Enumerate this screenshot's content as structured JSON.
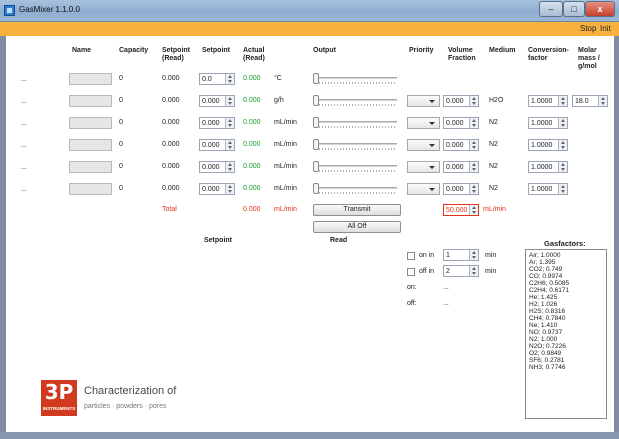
{
  "window": {
    "title": "GasMixer 1.1.0.0",
    "minimize": "–",
    "maximize": "□",
    "close": "x"
  },
  "menu": {
    "stop": "Stop",
    "init": "Init"
  },
  "headers": {
    "name": "Name",
    "capacity": "Capacity",
    "setpoint_read": "Setpoint\n(Read)",
    "setpoint": "Setpoint",
    "actual_read": "Actual\n(Read)",
    "output": "Output",
    "priority": "Priority",
    "volume_fraction": "Volume\nFraction",
    "medium": "Medium",
    "conversion_factor": "Conversion-\nfactor",
    "molar_mass": "Molar\nmass /\ng/mol"
  },
  "rows": [
    {
      "dots": "...",
      "capacity": "0",
      "setpoint_read": "0.000",
      "setpoint": "0.0",
      "actual": "0.000",
      "unit": "°C",
      "output_level": 0
    },
    {
      "dots": "...",
      "capacity": "0",
      "setpoint_read": "0.000",
      "setpoint": "0.000",
      "actual": "0.000",
      "unit": "g/h",
      "output_level": 0,
      "priority": "",
      "volume_fraction": "0.000",
      "medium": "H2O",
      "conversion_factor": "1.0000",
      "molar_mass": "18.0"
    },
    {
      "dots": "...",
      "capacity": "0",
      "setpoint_read": "0.000",
      "setpoint": "0.000",
      "actual": "0.000",
      "unit": "mL/min",
      "output_level": 0,
      "priority": "",
      "volume_fraction": "0.000",
      "medium": "N2",
      "conversion_factor": "1.0000"
    },
    {
      "dots": "...",
      "capacity": "0",
      "setpoint_read": "0.000",
      "setpoint": "0.000",
      "actual": "0.000",
      "unit": "mL/min",
      "output_level": 0,
      "priority": "",
      "volume_fraction": "0.000",
      "medium": "N2",
      "conversion_factor": "1.0000"
    },
    {
      "dots": "...",
      "capacity": "0",
      "setpoint_read": "0.000",
      "setpoint": "0.000",
      "actual": "0.000",
      "unit": "mL/min",
      "output_level": 0,
      "priority": "",
      "volume_fraction": "0.000",
      "medium": "N2",
      "conversion_factor": "1.0000"
    },
    {
      "dots": "...",
      "capacity": "0",
      "setpoint_read": "0.000",
      "setpoint": "0.000",
      "actual": "0.000",
      "unit": "mL/min",
      "output_level": 0,
      "priority": "",
      "volume_fraction": "0.000",
      "medium": "N2",
      "conversion_factor": "1.0000"
    }
  ],
  "total": {
    "label": "Total",
    "value": "0.000",
    "unit": "mL/min",
    "volume_fraction": "50.000",
    "vf_unit": "mL/min"
  },
  "buttons": {
    "transmit": "Transmit",
    "all_off": "All Off"
  },
  "sections": {
    "setpoint": "Setpoint",
    "read": "Read",
    "gasfactors": "Gasfactors:"
  },
  "timer": {
    "on_in_label": "on in",
    "on_in_value": "1",
    "off_in_label": "off in",
    "off_in_value": "2",
    "unit": "min",
    "on_label": "on:",
    "on_value": "...",
    "off_label": "off:",
    "off_value": "..."
  },
  "gasfactors": [
    "Air; 1.0000",
    "Ar; 1.395",
    "CO2; 0.749",
    "CO; 0.9974",
    "C2H6; 0.5085",
    "C2H4; 0.6171",
    "He; 1.425",
    "H2; 1.026",
    "H2S; 0.8316",
    "CH4; 0.7840",
    "Ne; 1.410",
    "NO; 0.9737",
    "N2; 1.000",
    "N2O; 0.7226",
    "O2; 0.9849",
    "SF6; 0.2781",
    "NH3; 0.7746"
  ],
  "logo": {
    "mark": "3P",
    "mark_sub": "INSTRUMENTS",
    "tagline": "Characterization of",
    "subtagline": "particles · powders · pores"
  },
  "colors": {
    "accent_bar": "#f6b13e",
    "actual_value": "#1a9a2a",
    "total": "#e3321a",
    "logo": "#d23a1f"
  }
}
